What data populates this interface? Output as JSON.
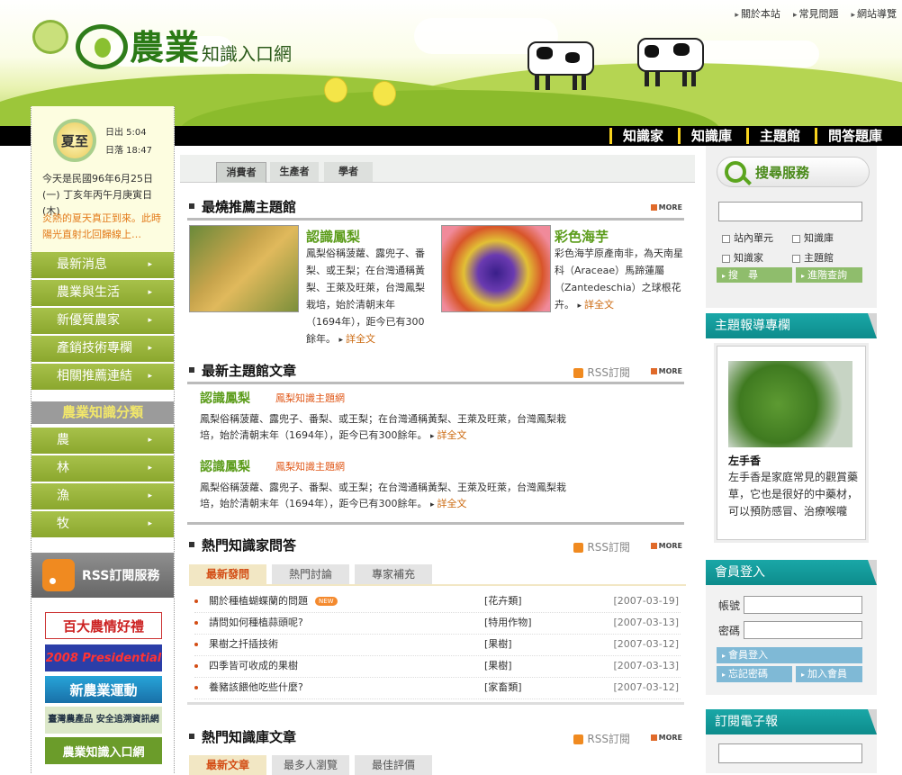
{
  "topnav": [
    "關於本站",
    "常見問題",
    "網站導覽"
  ],
  "logo": {
    "big": "農業",
    "small": "知識入口網"
  },
  "mainnav": [
    "知識家",
    "知識庫",
    "主題館",
    "問答題庫"
  ],
  "sun": {
    "term": "夏至",
    "sunrise": "日出 5:04",
    "sunset": "日落 18:47"
  },
  "date_text": "今天是民國96年6月25日(一) 丁亥年丙午月庚寅日(木)",
  "hot_text": "炎熱的夏天真正到來。此時陽光直射北回歸線上…",
  "left_menu": [
    "最新消息",
    "農業與生活",
    "新優質農家",
    "產銷技術專欄",
    "相關推薦連結"
  ],
  "category_head": "農業知識分類",
  "categories": [
    "農",
    "林",
    "漁",
    "牧"
  ],
  "rss_service": "RSS訂閱服務",
  "ads": [
    "百大農情好禮",
    "2008 Presidential",
    "新農業運動",
    "臺灣農產品 安全追溯資訊網",
    "農業知識入口網"
  ],
  "audience_tabs": [
    "消費者",
    "生產者",
    "學者"
  ],
  "sections": {
    "recommended": {
      "title": "最燒推薦主題館",
      "more": "MORE"
    },
    "latest": {
      "title": "最新主題館文章",
      "rss": "RSS訂閱",
      "more": "MORE"
    },
    "qa": {
      "title": "熱門知識家問答",
      "rss": "RSS訂閱",
      "more": "MORE"
    },
    "library": {
      "title": "熱門知識庫文章",
      "rss": "RSS訂閱",
      "more": "MORE"
    }
  },
  "featured": [
    {
      "title": "認識鳳梨",
      "desc": "鳳梨俗稱菠蘿、露兜子、番梨、或王梨；在台灣通稱黃梨、王萊及旺萊，台灣鳳梨栽培，始於清朝末年（1694年），距今已有300餘年。",
      "readmore": "詳全文"
    },
    {
      "title": "彩色海芋",
      "desc": "彩色海芋原產南非，為天南星科（Araceae）馬蹄蓮屬（Zantedeschia）之球根花卉。",
      "readmore": "詳全文"
    }
  ],
  "articles": [
    {
      "title": "認識鳳梨",
      "source": "鳳梨知識主題網",
      "desc": "鳳梨俗稱菠蘿、露兜子、番梨、或王梨；在台灣通稱黃梨、王萊及旺萊，台灣鳳梨栽培，始於清朝末年（1694年），距今已有300餘年。",
      "readmore": "詳全文"
    },
    {
      "title": "認識鳳梨",
      "source": "鳳梨知識主題網",
      "desc": "鳳梨俗稱菠蘿、露兜子、番梨、或王梨；在台灣通稱黃梨、王萊及旺萊，台灣鳳梨栽培，始於清朝末年（1694年），距今已有300餘年。",
      "readmore": "詳全文"
    }
  ],
  "qa_tabs": [
    "最新發問",
    "熱門討論",
    "專家補充"
  ],
  "qa_new_badge": "NEW",
  "qa_rows": [
    {
      "q": "關於種植蝴蝶蘭的問題",
      "cat": "[花卉類]",
      "date": "[2007-03-19]",
      "new": true
    },
    {
      "q": "請問如何種植蒜頭呢?",
      "cat": "[特用作物]",
      "date": "[2007-03-13]",
      "new": false
    },
    {
      "q": "果樹之扦插技術",
      "cat": "[果樹]",
      "date": "[2007-03-12]",
      "new": false
    },
    {
      "q": "四季皆可收成的果樹",
      "cat": "[果樹]",
      "date": "[2007-03-13]",
      "new": false
    },
    {
      "q": "養豬該餵他吃些什麼?",
      "cat": "[家畜類]",
      "date": "[2007-03-12]",
      "new": false
    }
  ],
  "library_tabs": [
    "最新文章",
    "最多人瀏覽",
    "最佳評價"
  ],
  "search": {
    "title": "搜尋服務",
    "options": [
      "站內單元",
      "知識庫",
      "知識家",
      "主題館"
    ],
    "search_btn": "搜　尋",
    "advanced_btn": "進階查詢"
  },
  "topic_column": {
    "title": "主題報導專欄",
    "item_title": "左手香",
    "item_desc": "左手香是家庭常見的觀賞藥草，它也是很好的中藥材，可以預防感冒、治療喉嚨痛、耳朵發炎、跌打損傷等"
  },
  "member": {
    "title": "會員登入",
    "account_label": "帳號",
    "password_label": "密碼",
    "login_btn": "會員登入",
    "forgot_btn": "忘記密碼",
    "join_btn": "加入會員"
  },
  "newsletter": {
    "title": "訂閱電子報"
  }
}
